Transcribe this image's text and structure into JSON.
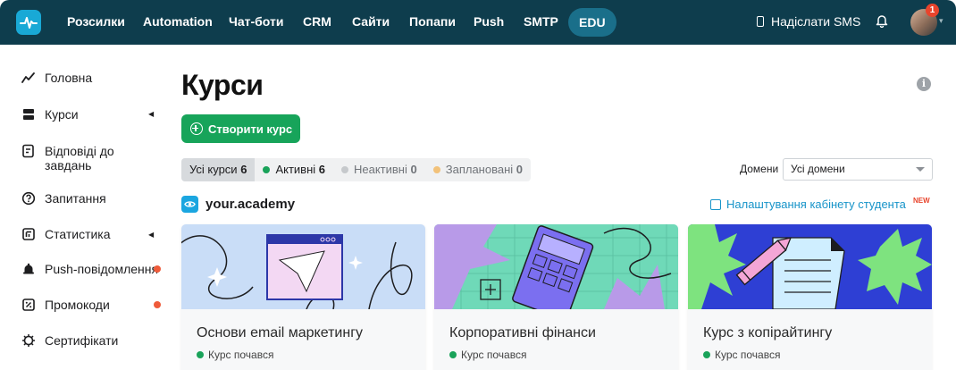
{
  "topbar": {
    "logo_icon": "pulse-logo-icon",
    "nav": [
      {
        "label": "Розсилки"
      },
      {
        "label": "Automation"
      },
      {
        "label": "Чат-боти"
      },
      {
        "label": "CRM"
      },
      {
        "label": "Сайти"
      },
      {
        "label": "Попапи"
      },
      {
        "label": "Push"
      },
      {
        "label": "SMTP"
      },
      {
        "label": "EDU",
        "active": true
      }
    ],
    "send_sms_label": "Надіслати SMS",
    "notifications_badge": "1"
  },
  "sidebar": {
    "items": [
      {
        "label": "Головна",
        "icon": "chart-line-icon"
      },
      {
        "label": "Курси",
        "icon": "courses-icon",
        "expandable": true
      },
      {
        "label": "Відповіді до завдань",
        "icon": "answers-icon"
      },
      {
        "label": "Запитання",
        "icon": "question-icon"
      },
      {
        "label": "Статистика",
        "icon": "statistics-icon",
        "expandable": true
      },
      {
        "label": "Push-повідомлення",
        "icon": "push-icon",
        "alert": true
      },
      {
        "label": "Промокоди",
        "icon": "promo-icon",
        "alert": true
      },
      {
        "label": "Сертифікати",
        "icon": "certificate-icon"
      }
    ]
  },
  "main": {
    "title": "Курси",
    "create_button": "Створити курс",
    "filters": [
      {
        "label": "Усі курси",
        "count": "6",
        "selected": true
      },
      {
        "label": "Активні",
        "count": "6",
        "dot_color": "#1aa35a"
      },
      {
        "label": "Неактивні",
        "count": "0",
        "dot_color": "#c6c9cc"
      },
      {
        "label": "Заплановані",
        "count": "0",
        "dot_color": "#f2c27a"
      }
    ],
    "domains_label": "Домени",
    "domains_selected": "Усі домени",
    "academy_name": "your.academy",
    "settings_link": "Налаштування кабінету студента",
    "new_badge": "NEW",
    "courses": [
      {
        "title": "Основи email маркетингу",
        "status": "Курс почався"
      },
      {
        "title": "Корпоративні фінанси",
        "status": "Курс почався"
      },
      {
        "title": "Курс з копірайтингу",
        "status": "Курс почався"
      }
    ]
  },
  "colors": {
    "topbar": "#0e3d4d",
    "accent_green": "#17a45a",
    "link_blue": "#1794c9",
    "alert_red": "#ef5b3a"
  }
}
